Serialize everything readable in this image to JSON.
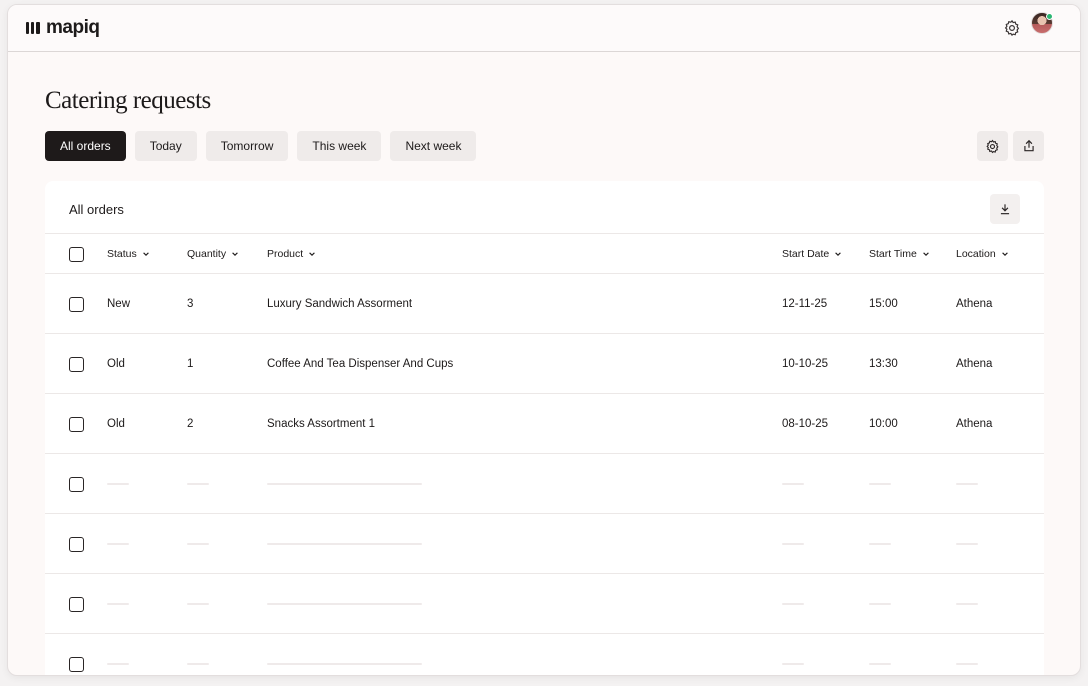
{
  "app": {
    "logo_text": "mapiq"
  },
  "header": {
    "settings_icon": "gear-icon",
    "avatar_alt": "user-avatar"
  },
  "page": {
    "title": "Catering requests"
  },
  "tabs": [
    {
      "label": "All orders",
      "active": true
    },
    {
      "label": "Today",
      "active": false
    },
    {
      "label": "Tomorrow",
      "active": false
    },
    {
      "label": "This week",
      "active": false
    },
    {
      "label": "Next week",
      "active": false
    }
  ],
  "toolbar": {
    "settings_icon": "gear-icon",
    "share_icon": "share-icon"
  },
  "card": {
    "title": "All orders",
    "download_icon": "download-icon"
  },
  "table": {
    "columns": {
      "status": "Status",
      "quantity": "Quantity",
      "product": "Product",
      "start_date": "Start Date",
      "start_time": "Start Time",
      "location": "Location"
    },
    "rows": [
      {
        "status": "New",
        "quantity": "3",
        "product": "Luxury Sandwich Assorment",
        "start_date": "12-11-25",
        "start_time": "15:00",
        "location": "Athena"
      },
      {
        "status": "Old",
        "quantity": "1",
        "product": "Coffee And Tea Dispenser And Cups",
        "start_date": "10-10-25",
        "start_time": "13:30",
        "location": "Athena"
      },
      {
        "status": "Old",
        "quantity": "2",
        "product": "Snacks Assortment 1",
        "start_date": "08-10-25",
        "start_time": "10:00",
        "location": "Athena"
      }
    ],
    "placeholder_rows": 4
  },
  "colors": {
    "accent": "#1e1a1a",
    "background": "#fdf9f8",
    "tab_bg": "#efebea",
    "online": "#2bb673"
  }
}
